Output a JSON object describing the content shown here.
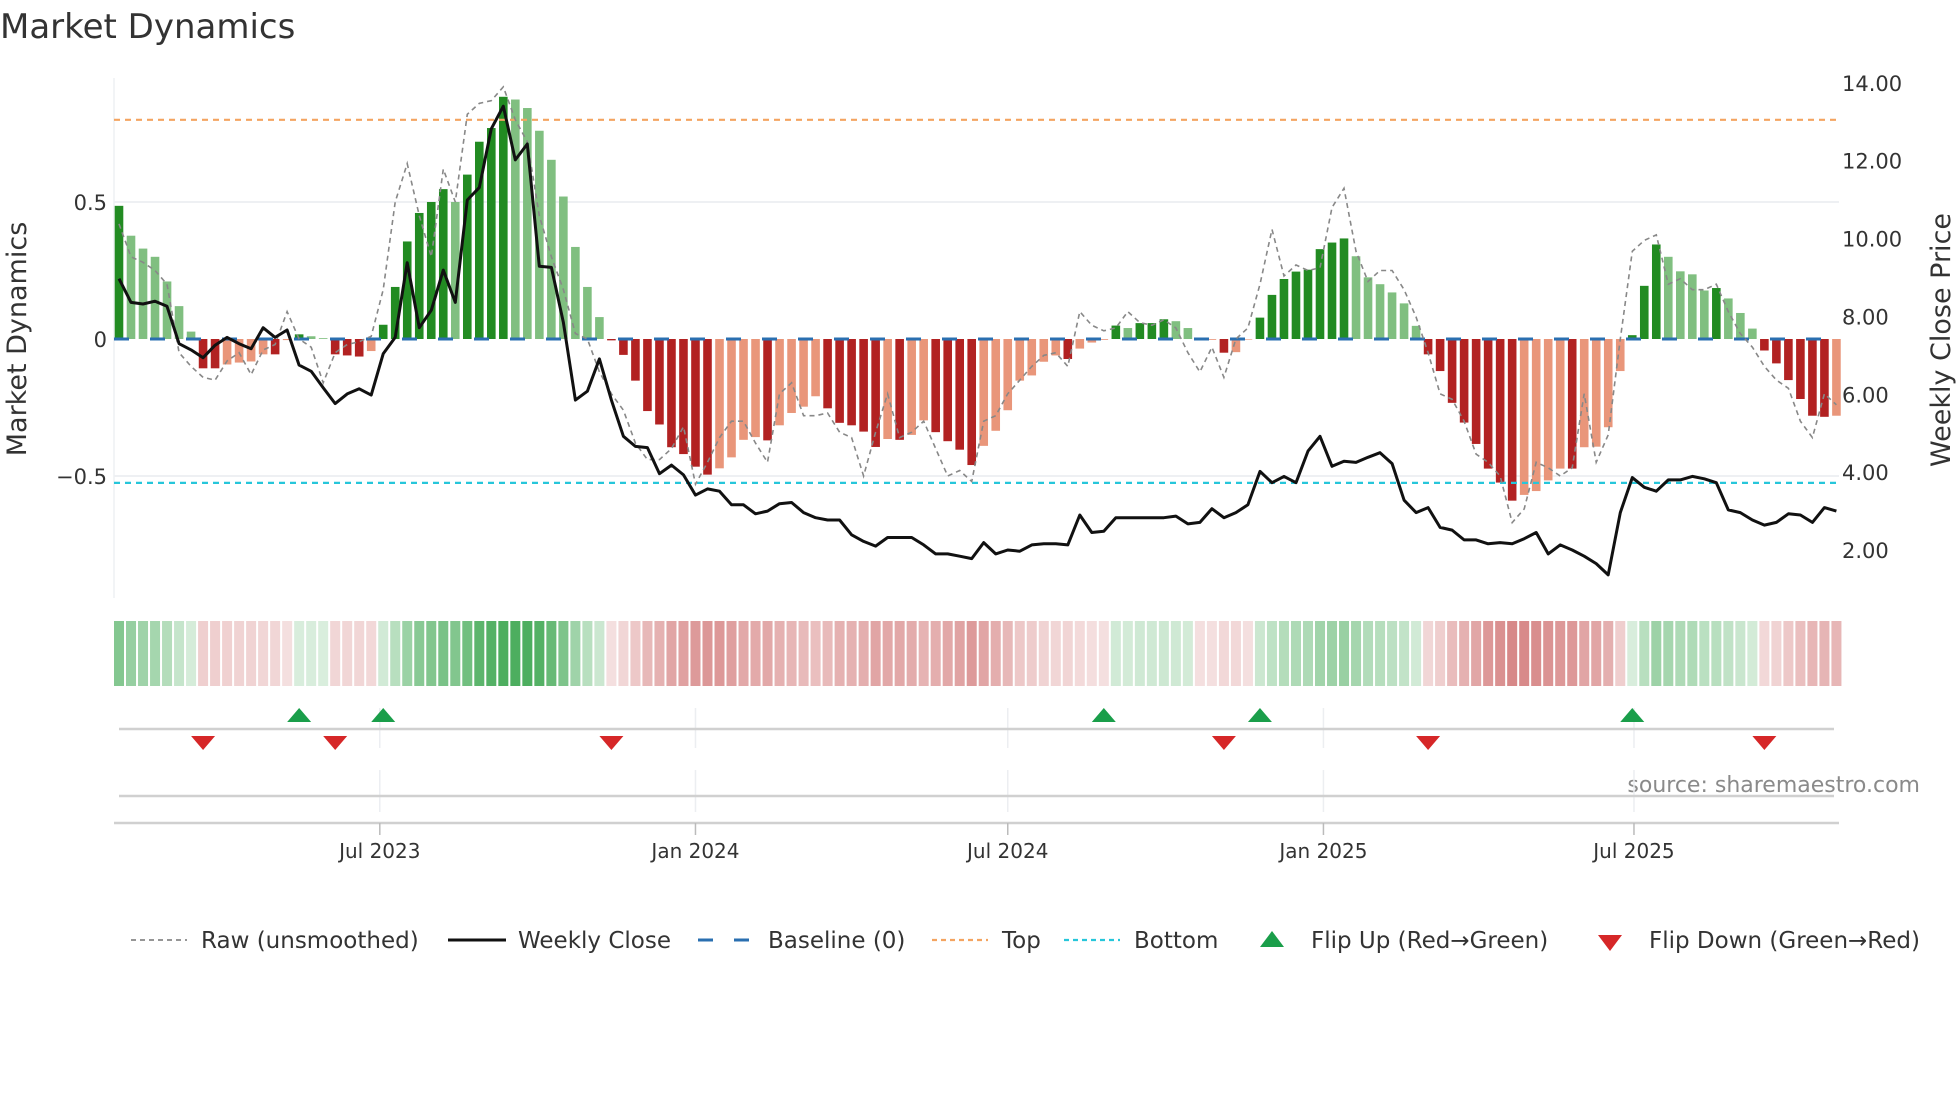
{
  "title": "Market Dynamics",
  "source": "source: sharemaestro.com",
  "chart_data": {
    "type": "bar",
    "title": "Market Dynamics",
    "frequency": "weekly",
    "start_date": "2023-01-30",
    "ylabel": "Market Dynamics",
    "ylabel_right": "Weekly Close Price",
    "ylim": [
      -0.945,
      0.955
    ],
    "ylim_right": [
      0.78,
      14.13
    ],
    "yticks": [
      {
        "v": 0.5,
        "label": "0.5"
      },
      {
        "v": 0,
        "label": "0"
      },
      {
        "v": -0.5,
        "label": "−0.5"
      }
    ],
    "yticks_right": [
      {
        "v": 14,
        "label": "14.00"
      },
      {
        "v": 12,
        "label": "12.00"
      },
      {
        "v": 10,
        "label": "10.00"
      },
      {
        "v": 8,
        "label": "8.00"
      },
      {
        "v": 6,
        "label": "6.00"
      },
      {
        "v": 4,
        "label": "4.00"
      },
      {
        "v": 2,
        "label": "2.00"
      }
    ],
    "xticks": [
      {
        "date": "2023-07-01",
        "label": "Jul 2023"
      },
      {
        "date": "2024-01-01",
        "label": "Jan 2024"
      },
      {
        "date": "2024-07-01",
        "label": "Jul 2024"
      },
      {
        "date": "2025-01-01",
        "label": "Jan 2025"
      },
      {
        "date": "2025-07-01",
        "label": "Jul 2025"
      }
    ],
    "grid": true,
    "legend_position": "bottom",
    "levels": {
      "baseline": 0,
      "top": 0.8,
      "bottom": -0.525
    },
    "colors": {
      "up_strong": "#228b22",
      "up_weak": "#80bf80",
      "down_strong": "#b22222",
      "down_weak": "#e9967a",
      "raw": "#888888",
      "close": "#111111",
      "baseline": "#2a6fb0",
      "top": "#f4a460",
      "bottom": "#26c6da",
      "flip_up": "#1a9e4a",
      "flip_down": "#d62728"
    },
    "shades": "DLLLLLLDDLLLLDLDLLDDDLDDDDDDLDDDDLLLLLLLLDDDDDDDDDLLLLDLLLLDDDDDLDLLDDDDLLLLLLLDLLLDLDDDLLLLDLLDDDDDDDDLLLLLLDDDDDDDDLLLLDLLLLDDDLLLLDLLLDDDDDDL",
    "values": [
      0.486,
      0.377,
      0.33,
      0.3,
      0.21,
      0.12,
      0.027,
      -0.107,
      -0.107,
      -0.093,
      -0.086,
      -0.082,
      -0.056,
      -0.056,
      -0.004,
      0.017,
      0.01,
      0.003,
      -0.056,
      -0.06,
      -0.064,
      -0.044,
      0.052,
      0.19,
      0.356,
      0.46,
      0.5,
      0.547,
      0.5,
      0.6,
      0.72,
      0.77,
      0.884,
      0.874,
      0.843,
      0.76,
      0.654,
      0.52,
      0.336,
      0.19,
      0.08,
      -0.005,
      -0.058,
      -0.152,
      -0.263,
      -0.312,
      -0.395,
      -0.42,
      -0.466,
      -0.495,
      -0.472,
      -0.432,
      -0.368,
      -0.358,
      -0.37,
      -0.315,
      -0.27,
      -0.247,
      -0.209,
      -0.253,
      -0.306,
      -0.315,
      -0.338,
      -0.394,
      -0.365,
      -0.368,
      -0.35,
      -0.297,
      -0.34,
      -0.373,
      -0.404,
      -0.46,
      -0.39,
      -0.335,
      -0.26,
      -0.152,
      -0.133,
      -0.083,
      -0.06,
      -0.073,
      -0.035,
      -0.013,
      -0.003,
      0.049,
      0.04,
      0.058,
      0.058,
      0.072,
      0.065,
      0.04,
      -0.003,
      -0.003,
      -0.05,
      -0.048,
      -0.002,
      0.078,
      0.161,
      0.219,
      0.246,
      0.253,
      0.328,
      0.352,
      0.367,
      0.302,
      0.225,
      0.2,
      0.17,
      0.13,
      0.048,
      -0.056,
      -0.117,
      -0.233,
      -0.305,
      -0.383,
      -0.473,
      -0.524,
      -0.59,
      -0.569,
      -0.555,
      -0.516,
      -0.473,
      -0.473,
      -0.395,
      -0.393,
      -0.322,
      -0.117,
      0.014,
      0.194,
      0.345,
      0.3,
      0.247,
      0.236,
      0.177,
      0.186,
      0.148,
      0.095,
      0.038,
      -0.042,
      -0.089,
      -0.15,
      -0.219,
      -0.28,
      -0.284,
      -0.28
    ],
    "raw": [
      0.42,
      0.3,
      0.28,
      0.25,
      0.2,
      -0.05,
      -0.1,
      -0.14,
      -0.15,
      -0.08,
      -0.05,
      -0.13,
      -0.04,
      -0.02,
      0.1,
      0.0,
      -0.03,
      -0.16,
      -0.05,
      -0.02,
      -0.01,
      0.01,
      0.18,
      0.5,
      0.64,
      0.45,
      0.3,
      0.62,
      0.5,
      0.82,
      0.86,
      0.87,
      0.92,
      0.8,
      0.72,
      0.45,
      0.3,
      0.18,
      0.02,
      0.0,
      -0.12,
      -0.2,
      -0.26,
      -0.38,
      -0.44,
      -0.44,
      -0.4,
      -0.32,
      -0.53,
      -0.45,
      -0.36,
      -0.3,
      -0.3,
      -0.38,
      -0.45,
      -0.2,
      -0.16,
      -0.28,
      -0.28,
      -0.27,
      -0.34,
      -0.36,
      -0.5,
      -0.34,
      -0.2,
      -0.36,
      -0.34,
      -0.3,
      -0.4,
      -0.5,
      -0.48,
      -0.52,
      -0.3,
      -0.28,
      -0.2,
      -0.15,
      -0.1,
      -0.06,
      -0.05,
      -0.1,
      0.1,
      0.05,
      0.03,
      0.04,
      0.1,
      0.06,
      0.05,
      0.07,
      0.04,
      -0.05,
      -0.12,
      -0.03,
      -0.14,
      0.0,
      0.04,
      0.2,
      0.4,
      0.23,
      0.27,
      0.25,
      0.26,
      0.48,
      0.55,
      0.32,
      0.21,
      0.25,
      0.25,
      0.18,
      0.08,
      -0.05,
      -0.2,
      -0.22,
      -0.3,
      -0.42,
      -0.45,
      -0.5,
      -0.67,
      -0.62,
      -0.45,
      -0.47,
      -0.5,
      -0.47,
      -0.2,
      -0.45,
      -0.35,
      0.0,
      0.32,
      0.36,
      0.38,
      0.2,
      0.22,
      0.18,
      0.18,
      0.2,
      0.1,
      0.02,
      -0.03,
      -0.1,
      -0.15,
      -0.18,
      -0.3,
      -0.36,
      -0.2,
      -0.24
    ],
    "close": [
      8.97,
      8.36,
      8.32,
      8.39,
      8.26,
      7.3,
      7.14,
      6.94,
      7.26,
      7.46,
      7.3,
      7.17,
      7.71,
      7.46,
      7.65,
      6.75,
      6.59,
      6.17,
      5.76,
      6.01,
      6.14,
      5.98,
      7.04,
      7.46,
      9.38,
      7.71,
      8.16,
      9.19,
      8.36,
      10.99,
      11.31,
      12.82,
      13.4,
      12.02,
      12.43,
      9.29,
      9.26,
      7.84,
      5.85,
      6.08,
      6.91,
      5.85,
      4.92,
      4.66,
      4.63,
      3.96,
      4.18,
      3.93,
      3.41,
      3.57,
      3.51,
      3.16,
      3.16,
      2.93,
      3.0,
      3.19,
      3.22,
      2.96,
      2.83,
      2.77,
      2.77,
      2.39,
      2.22,
      2.1,
      2.32,
      2.32,
      2.32,
      2.13,
      1.9,
      1.9,
      1.84,
      1.78,
      2.19,
      1.9,
      2.0,
      1.97,
      2.13,
      2.16,
      2.16,
      2.13,
      2.9,
      2.45,
      2.48,
      2.83,
      2.83,
      2.83,
      2.83,
      2.83,
      2.87,
      2.67,
      2.71,
      3.06,
      2.83,
      2.96,
      3.16,
      4.02,
      3.73,
      3.89,
      3.73,
      4.54,
      4.92,
      4.15,
      4.28,
      4.25,
      4.38,
      4.5,
      4.22,
      3.28,
      2.96,
      3.09,
      2.58,
      2.51,
      2.26,
      2.26,
      2.16,
      2.19,
      2.16,
      2.29,
      2.45,
      1.9,
      2.13,
      2.0,
      1.84,
      1.65,
      1.36,
      2.96,
      3.86,
      3.61,
      3.51,
      3.8,
      3.8,
      3.89,
      3.83,
      3.73,
      3.03,
      2.96,
      2.77,
      2.64,
      2.71,
      2.93,
      2.9,
      2.71,
      3.09,
      3.0
    ],
    "flips_up": [
      "2023-05-15",
      "2023-07-03",
      "2024-08-26",
      "2024-11-25",
      "2025-06-30"
    ],
    "flips_down": [
      "2023-03-20",
      "2023-06-05",
      "2023-11-13",
      "2024-11-04",
      "2025-03-03",
      "2025-09-15"
    ],
    "legend": [
      {
        "key": "raw",
        "label": "Raw (unsmoothed)"
      },
      {
        "key": "close",
        "label": "Weekly Close"
      },
      {
        "key": "baseline",
        "label": "Baseline (0)"
      },
      {
        "key": "top",
        "label": "Top"
      },
      {
        "key": "bottom",
        "label": "Bottom"
      },
      {
        "key": "flip_up",
        "label": "Flip Up (Red→Green)"
      },
      {
        "key": "flip_down",
        "label": "Flip Down (Green→Red)"
      }
    ]
  }
}
